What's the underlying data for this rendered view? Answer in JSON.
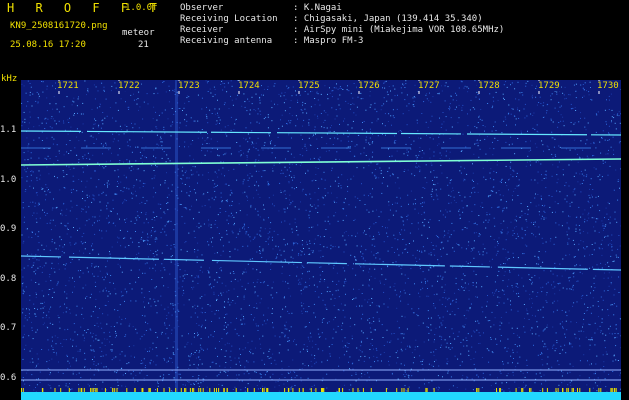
{
  "header": {
    "app_title": "H R O F F T",
    "version": "1.0.0f",
    "filename": "KN9_2508161720.png",
    "program": "meteor",
    "datetime": "25.08.16 17:20",
    "count": "21",
    "info": [
      {
        "label": "Observer",
        "value": ": K.Nagai"
      },
      {
        "label": "Receiving Location",
        "value": ": Chigasaki, Japan (139.414 35.340)"
      },
      {
        "label": "Receiver",
        "value": ": AirSpy mini (Miakejima VOR 108.65MHz)"
      },
      {
        "label": "Receiving antenna",
        "value": ": Maspro FM-3"
      }
    ]
  },
  "axis": {
    "unit": "kHz",
    "y_ticks": [
      "1.1",
      "1.0",
      "0.9",
      "0.8",
      "0.7",
      "0.6"
    ],
    "x_ticks": [
      "1721",
      "1722",
      "1723",
      "1724",
      "1725",
      "1726",
      "1727",
      "1728",
      "1729",
      "1730"
    ]
  },
  "colors": {
    "background": "#000000",
    "spectrogram_bg": "#0c1a78",
    "label_yellow": "#f0e000",
    "label_white": "#e8e8e8",
    "signal": "#7fffd4",
    "baseline": "#22d8ff"
  }
}
